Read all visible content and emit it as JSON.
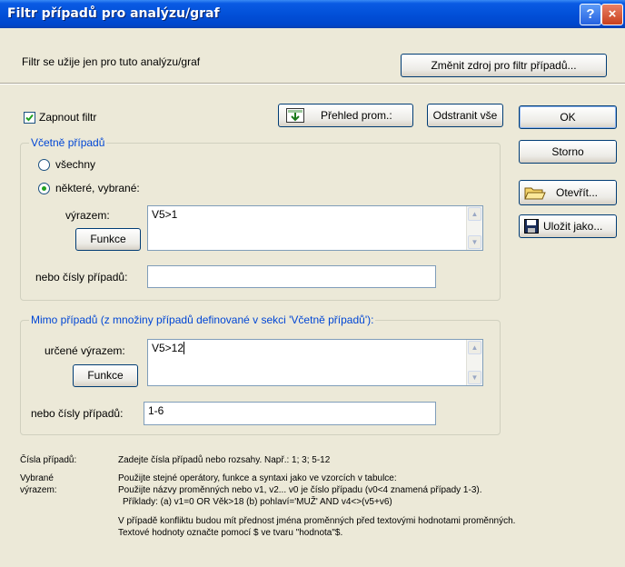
{
  "window": {
    "title": "Filtr případů pro analýzu/graf",
    "help_icon": "?",
    "close_icon": "×"
  },
  "header": {
    "note": "Filtr se užije jen pro tuto analýzu/graf",
    "change_source_button": "Změnit zdroj pro filtr případů..."
  },
  "filter": {
    "enable_label": "Zapnout filtr",
    "enable_checked": true,
    "variables_button": "Přehled prom.:",
    "remove_all_button": "Odstranit vše"
  },
  "side_buttons": {
    "ok": "OK",
    "cancel": "Storno",
    "open": "Otevřít...",
    "save_as": "Uložit jako..."
  },
  "include": {
    "group_title": "Včetně případů",
    "all_label": "všechny",
    "some_label": "některé, vybrané:",
    "selected_option": "some",
    "expression_label": "výrazem:",
    "expression_value": "V5>1",
    "function_button": "Funkce",
    "cases_label": "nebo čísly případů:",
    "cases_value": ""
  },
  "exclude": {
    "group_title": "Mimo případů (z množiny případů definované v sekci 'Včetně případů'):",
    "expression_label": "určené výrazem:",
    "expression_value": "V5>12",
    "function_button": "Funkce",
    "cases_label": "nebo čísly případů:",
    "cases_value": "1-6"
  },
  "help": {
    "case_numbers_label": "Čísla případů:",
    "case_numbers_text": "Zadejte čísla případů nebo rozsahy.  Např.:  1; 3; 5-12",
    "selected_label_1": "Vybrané",
    "selected_label_2": "výrazem:",
    "line1": "Použijte stejné operátory, funkce a syntaxi jako ve vzorcích v tabulce:",
    "line2": "Použijte názvy proměnných nebo v1, v2...   v0 je číslo případu  (v0<4 znamená případy 1-3).",
    "line3": "Příklady:  (a) v1=0 OR Věk>18   (b) pohlaví='MUŽ' AND v4<>(v5+v6)",
    "line4": "V případě konfliktu budou mít přednost jména proměnných před textovými hodnotami proměnných.",
    "line5": "Textové hodnoty označte pomocí $ ve tvaru \"hodnota\"$."
  }
}
